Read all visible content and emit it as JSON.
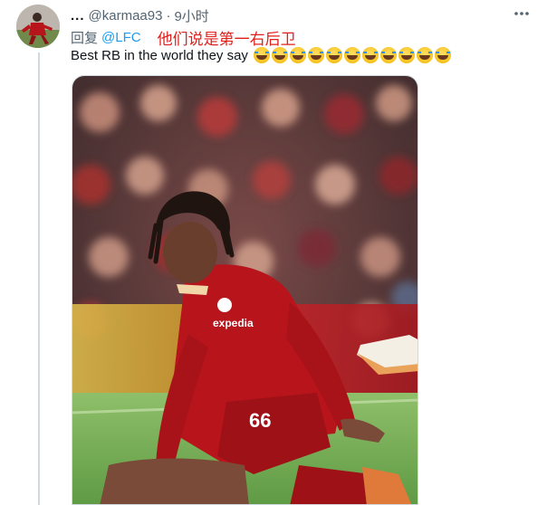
{
  "tweet": {
    "header": {
      "dots": "...",
      "handle": "@karmaa93",
      "separator": "·",
      "time": "9小时"
    },
    "reply": {
      "prefix": "回复",
      "mention": "@LFC",
      "annotation": "他们说是第一右后卫"
    },
    "text": "Best RB in the world they say",
    "emoji_count": 11,
    "emoji_name": "face-with-tears-of-joy-emoji",
    "media": {
      "shirt_sponsor": "expedia",
      "shirt_number": "66"
    }
  },
  "colors": {
    "link": "#1d9bf0",
    "annotation": "#e0201b",
    "muted": "#536471",
    "text": "#0f1419",
    "kit_red": "#b8141c"
  }
}
